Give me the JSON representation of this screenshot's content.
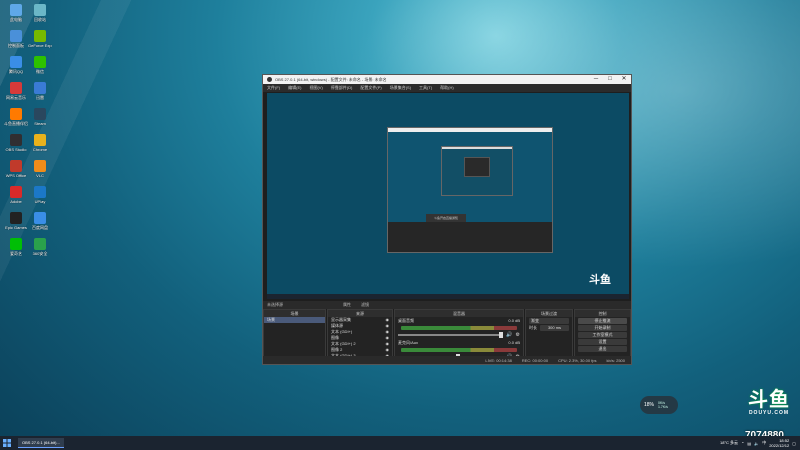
{
  "desktop": {
    "icons": [
      {
        "label": "此电脑",
        "color": "#5fa8e8"
      },
      {
        "label": "回收站",
        "color": "#6bb7c7"
      },
      {
        "label": "控制面板",
        "color": "#4a90d9"
      },
      {
        "label": "GeForce Experience",
        "color": "#76b900"
      },
      {
        "label": "腾讯QQ",
        "color": "#3a8ee6"
      },
      {
        "label": "微信",
        "color": "#2dc100"
      },
      {
        "label": "网易云音乐",
        "color": "#d63a3a"
      },
      {
        "label": "迅雷",
        "color": "#3a7bd5"
      },
      {
        "label": "斗鱼直播伴侣",
        "color": "#ff7a00"
      },
      {
        "label": "Steam",
        "color": "#2a475e"
      },
      {
        "label": "OBS Studio",
        "color": "#302e31"
      },
      {
        "label": "Chrome",
        "color": "#e8b21c"
      },
      {
        "label": "WPS Office",
        "color": "#c03a2b"
      },
      {
        "label": "VLC",
        "color": "#f08c1a"
      },
      {
        "label": "Adobe",
        "color": "#d92a2a"
      },
      {
        "label": "UPlay",
        "color": "#1b78c8"
      },
      {
        "label": "Epic Games",
        "color": "#222222"
      },
      {
        "label": "百度网盘",
        "color": "#3a8ee6"
      },
      {
        "label": "爱奇艺",
        "color": "#00be06"
      },
      {
        "label": "360安全",
        "color": "#2aa14b"
      }
    ]
  },
  "obs": {
    "title": "OBS 27.0.1 (64-bit, windows) - 配置文件: 未命名 - 场景: 未命名",
    "window_buttons": {
      "min": "─",
      "max": "□",
      "close": "✕"
    },
    "menu": [
      "文件(F)",
      "编辑(E)",
      "视图(V)",
      "停靠部件(D)",
      "配置文件(P)",
      "场景集合(S)",
      "工具(T)",
      "帮助(H)"
    ],
    "docks_bar": {
      "label": "未选择源",
      "props": "属性",
      "filters": "滤镜"
    },
    "scenes": {
      "header": "场景",
      "items": [
        "场景"
      ]
    },
    "sources": {
      "header": "来源",
      "items": [
        "显示器采集",
        "媒体源",
        "文本 (GDI+)",
        "图像",
        "文本 (GDI+) 2",
        "图像 2",
        "文本 (GDI+) 3",
        "文本 (GDI+) 4"
      ]
    },
    "mixer": {
      "header": "混音器",
      "channels": [
        {
          "name": "桌面音频",
          "db": "0.0 dB"
        },
        {
          "name": "麦克风/Aux",
          "db": "0.0 dB"
        }
      ]
    },
    "transitions": {
      "header": "场景过渡",
      "type": "渐变",
      "duration_label": "时长",
      "duration": "300 ms"
    },
    "controls": {
      "header": "控制",
      "buttons": [
        "停止推流",
        "开始录制",
        "工作室模式",
        "设置",
        "退出"
      ]
    },
    "status": {
      "live": "LIVE: 00:14:38",
      "rec": "REC: 00:00:00",
      "cpu": "CPU: 2.3%, 30.00 fps",
      "kbps": "kb/s: 2500"
    }
  },
  "overlay": {
    "douyu_logo": "斗鱼",
    "douyu_word": "DOUYU.COM",
    "room_id": "7074880",
    "net": {
      "pct": "18%",
      "up": "0K/s",
      "down": "1.7K/s"
    }
  },
  "taskbar": {
    "item": "OBS 27.0.1 (64-bit)...",
    "clock_time": "18:52",
    "clock_date": "2022/12/12",
    "weather": "18°C 多云",
    "lang": "中"
  }
}
